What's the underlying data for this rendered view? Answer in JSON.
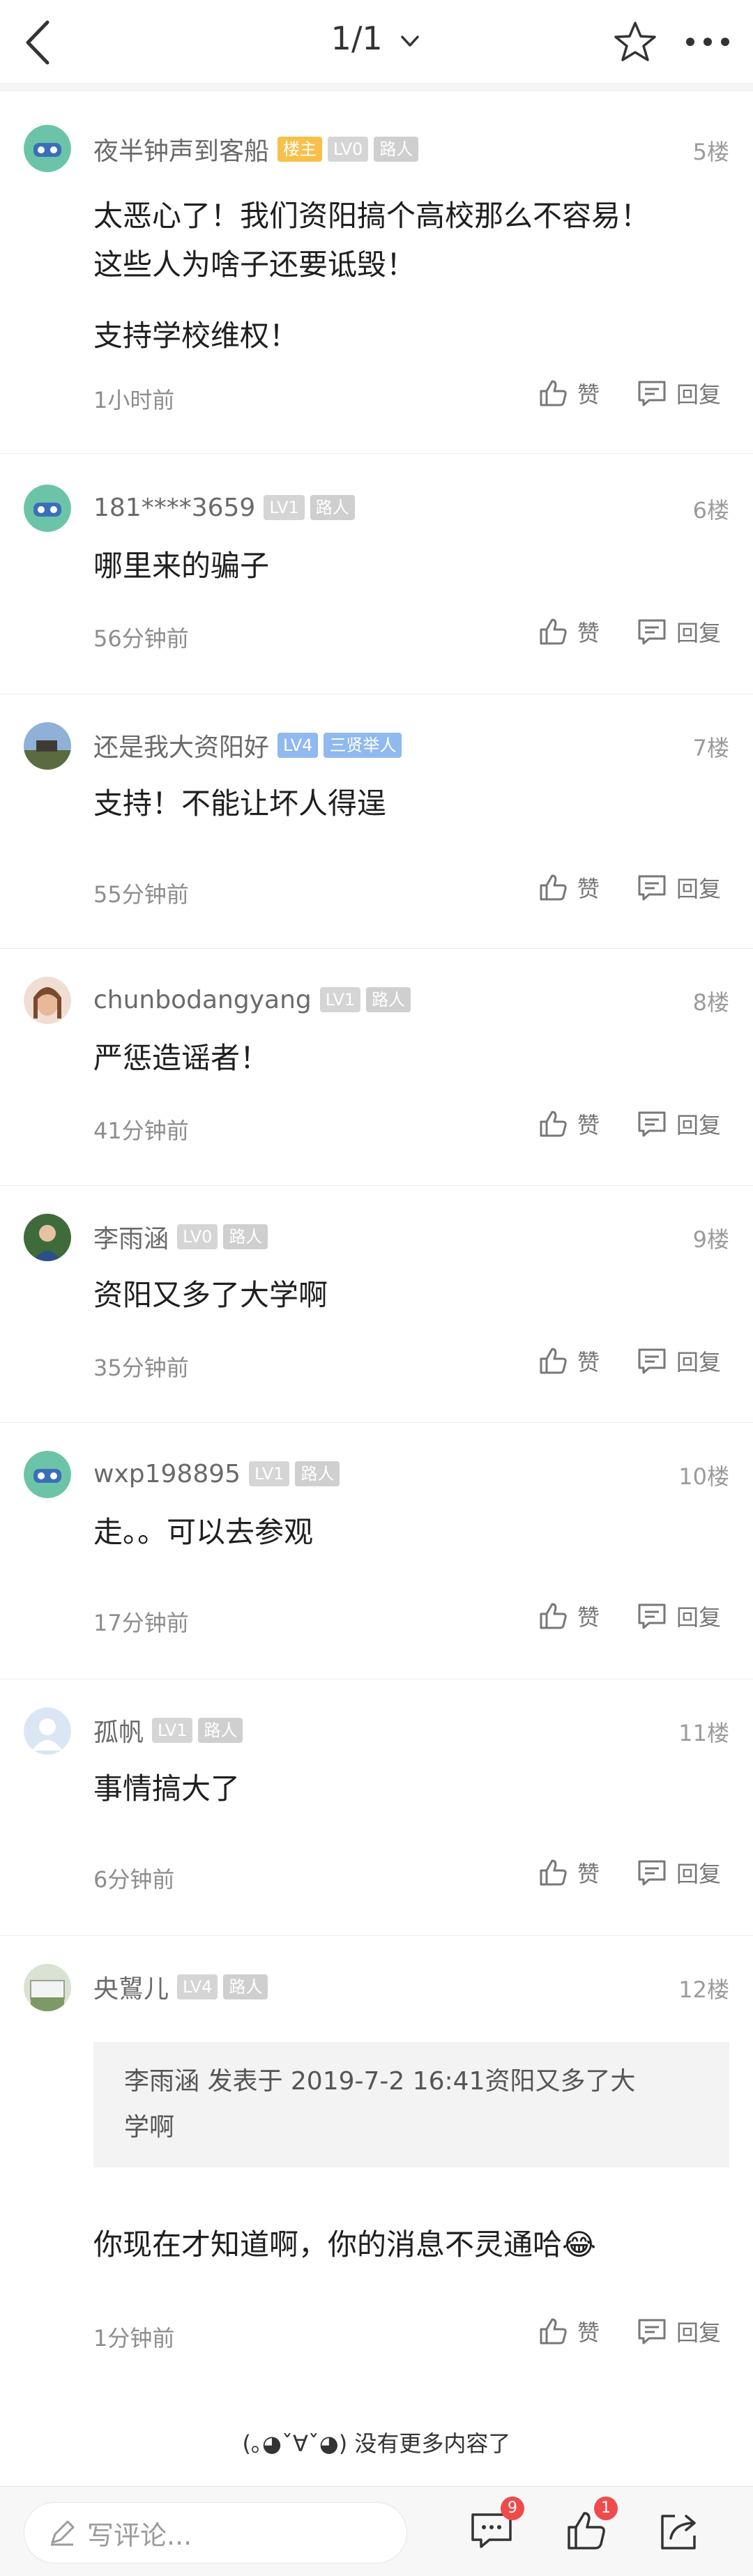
{
  "header": {
    "page_indicator": "1/1"
  },
  "actions": {
    "like_label": "赞",
    "reply_label": "回复"
  },
  "comments": [
    {
      "username": "夜半钟声到客船",
      "badges": [
        "楼主",
        "LV0",
        "路人"
      ],
      "floor": "5楼",
      "content": [
        "太恶心了！我们资阳搞个高校那么不容易！",
        "这些人为啥子还要诋毁！",
        "支持学校维权！"
      ],
      "time": "1小时前"
    },
    {
      "username": "181****3659",
      "badges": [
        "LV1",
        "路人"
      ],
      "floor": "6楼",
      "content": [
        "哪里来的骗子"
      ],
      "time": "56分钟前"
    },
    {
      "username": "还是我大资阳好",
      "badges": [
        "LV4",
        "三贤举人"
      ],
      "floor": "7楼",
      "content": [
        "支持！不能让坏人得逞"
      ],
      "time": "55分钟前"
    },
    {
      "username": "chunbodangyang",
      "badges": [
        "LV1",
        "路人"
      ],
      "floor": "8楼",
      "content": [
        "严惩造谣者！"
      ],
      "time": "41分钟前"
    },
    {
      "username": "李雨涵",
      "badges": [
        "LV0",
        "路人"
      ],
      "floor": "9楼",
      "content": [
        "资阳又多了大学啊"
      ],
      "time": "35分钟前"
    },
    {
      "username": "wxp198895",
      "badges": [
        "LV1",
        "路人"
      ],
      "floor": "10楼",
      "content": [
        "走。。可以去参观"
      ],
      "time": "17分钟前"
    },
    {
      "username": "孤帆",
      "badges": [
        "LV1",
        "路人"
      ],
      "floor": "11楼",
      "content": [
        "事情搞大了"
      ],
      "time": "6分钟前"
    },
    {
      "username": "央鶦儿",
      "badges": [
        "LV4",
        "路人"
      ],
      "floor": "12楼",
      "quote": [
        "李雨涵 发表于 2019-7-2 16:41资阳又多了大",
        "学啊"
      ],
      "content": [
        "你现在才知道啊，你的消息不灵通哈😂"
      ],
      "time": "1分钟前"
    }
  ],
  "footer": {
    "no_more": "(｡◕ˇ∀ˇ◕) 没有更多内容了"
  },
  "bottom_bar": {
    "comment_placeholder": "写评论...",
    "comment_count": "9",
    "like_count": "1"
  },
  "colors": {
    "host_badge": "#f7c04a",
    "level_badge": "#d5d5d5",
    "blue_badge": "#8fb9ef",
    "notification_red": "#ef4b4b"
  },
  "icons": [
    "back-icon",
    "chevron-down-icon",
    "star-icon",
    "more-icon",
    "thumbs-up-icon",
    "reply-icon",
    "pen-icon",
    "comment-icon",
    "share-icon"
  ]
}
